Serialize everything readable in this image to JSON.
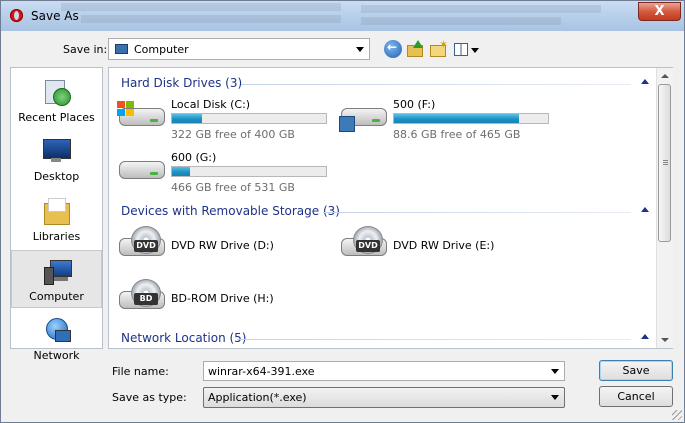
{
  "window": {
    "title": "Save As",
    "close_glyph": "X"
  },
  "toolbar": {
    "save_in_label": "Save in:",
    "save_in_value": "Computer",
    "icons": [
      "back-icon",
      "up-folder-icon",
      "new-folder-icon",
      "views-icon"
    ]
  },
  "places": [
    {
      "label": "Recent Places",
      "icon": "recent-places-icon"
    },
    {
      "label": "Desktop",
      "icon": "desktop-icon"
    },
    {
      "label": "Libraries",
      "icon": "libraries-icon"
    },
    {
      "label": "Computer",
      "icon": "computer-icon",
      "selected": true
    },
    {
      "label": "Network",
      "icon": "network-icon"
    }
  ],
  "groups": {
    "hard_disks": "Hard Disk Drives (3)",
    "removable": "Devices with Removable Storage (3)",
    "network": "Network Location (5)"
  },
  "drives": [
    {
      "name": "Local Disk (C:)",
      "free": "322 GB free of 400 GB",
      "used_fraction": 0.195,
      "icon": "system-drive-icon"
    },
    {
      "name": "500 (F:)",
      "free": "88.6 GB free of 465 GB",
      "used_fraction": 0.81,
      "icon": "network-drive-icon"
    },
    {
      "name": "600 (G:)",
      "free": "466 GB free of 531 GB",
      "used_fraction": 0.12,
      "icon": "hard-drive-icon"
    }
  ],
  "removable": [
    {
      "name": "DVD RW Drive (D:)",
      "badge": "DVD",
      "icon": "dvd-drive-icon"
    },
    {
      "name": "DVD RW Drive (E:)",
      "badge": "DVD",
      "icon": "dvd-drive-icon"
    },
    {
      "name": "BD-ROM Drive (H:)",
      "badge": "BD",
      "icon": "bd-drive-icon"
    }
  ],
  "form": {
    "file_name_label": "File name:",
    "file_name_value": "winrar-x64-391.exe",
    "save_type_label": "Save as type:",
    "save_type_value": "Application(*.exe)"
  },
  "buttons": {
    "save": "Save",
    "cancel": "Cancel"
  }
}
